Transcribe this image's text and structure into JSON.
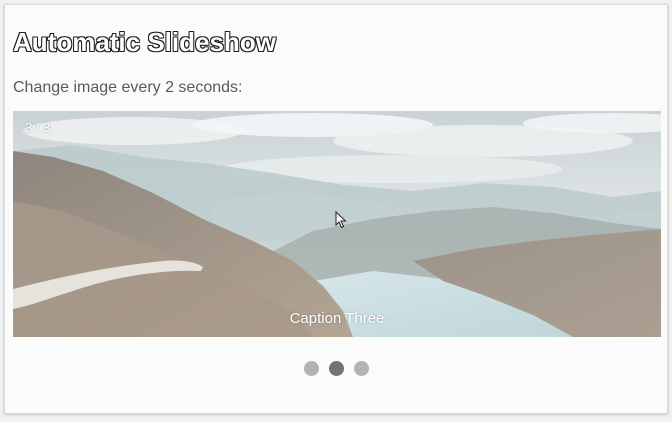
{
  "page": {
    "title": "Automatic Slideshow",
    "subtitle": "Change image every 2 seconds:"
  },
  "slideshow": {
    "number_text": "3 / 3",
    "caption": "Caption Three",
    "image": "mountain-lake-landscape",
    "active_slide": 2,
    "dot_count": 3
  },
  "colors": {
    "dot_inactive": "#b3b3b3",
    "dot_active": "#6b757a",
    "background": "#fbfbfb"
  }
}
